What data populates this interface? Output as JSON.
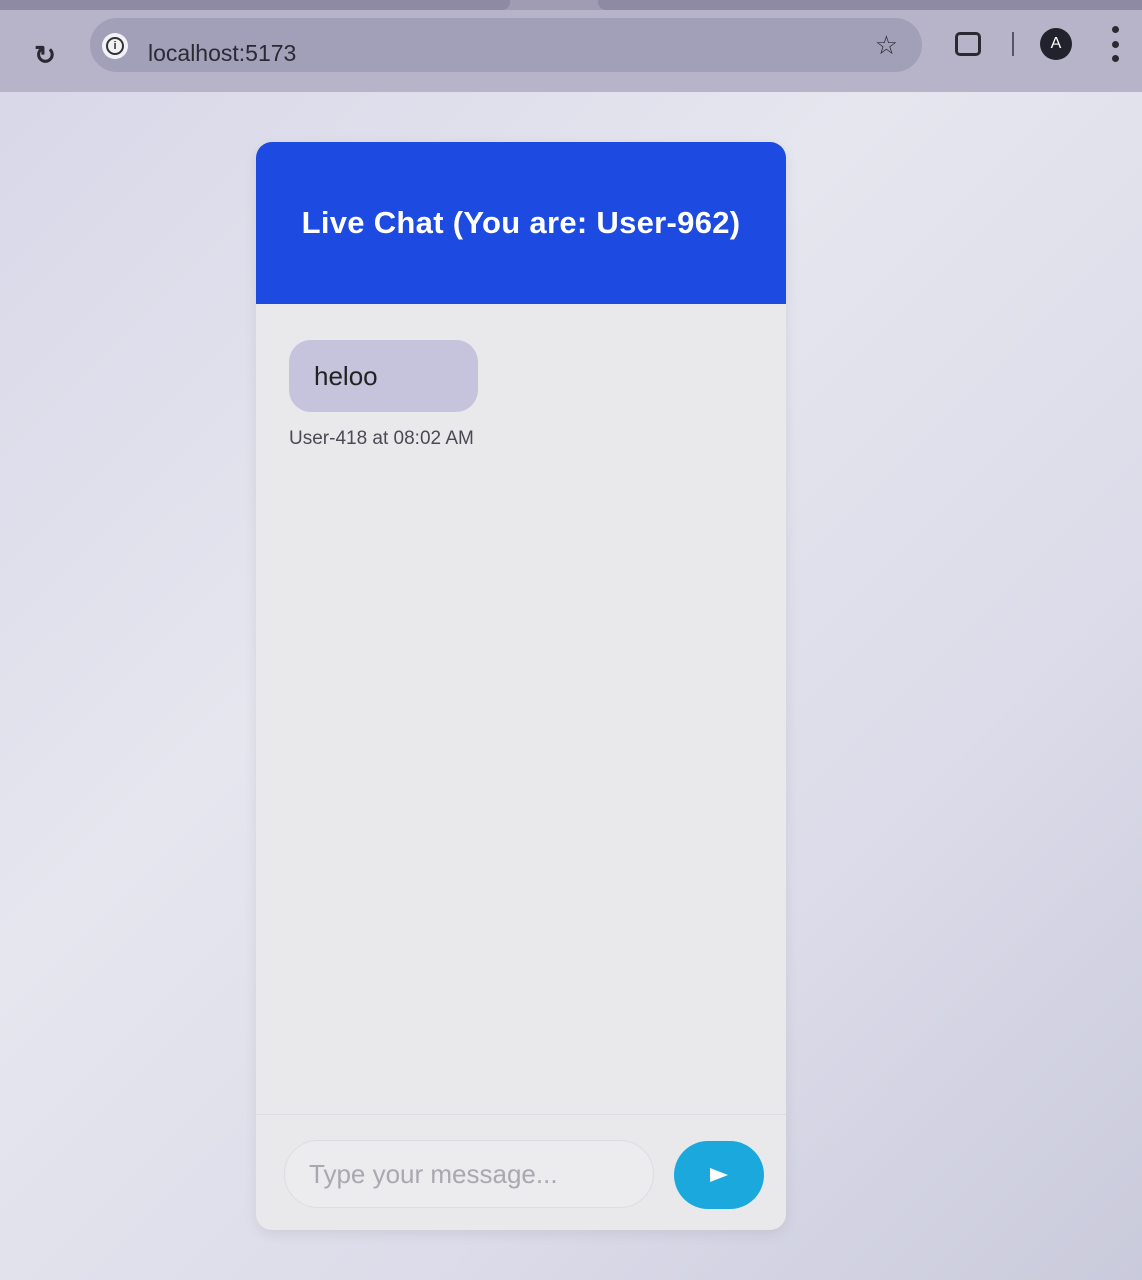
{
  "browser": {
    "url": "localhost:5173",
    "profile_initial": "A",
    "icons": {
      "reload": "reload-icon",
      "site_info": "info-icon",
      "bookmark": "star-icon",
      "extensions": "puzzle-icon",
      "menu": "kebab-menu-icon"
    }
  },
  "chat": {
    "title": "Live Chat (You are: User-962)",
    "messages": [
      {
        "text": "heloo",
        "meta": "User-418 at 08:02 AM"
      }
    ],
    "input_placeholder": "Type your message...",
    "send_icon": "send-icon"
  },
  "colors": {
    "header": "#1d4ae0",
    "bubble": "#c6c3dc",
    "send_button": "#1aa8dd"
  }
}
